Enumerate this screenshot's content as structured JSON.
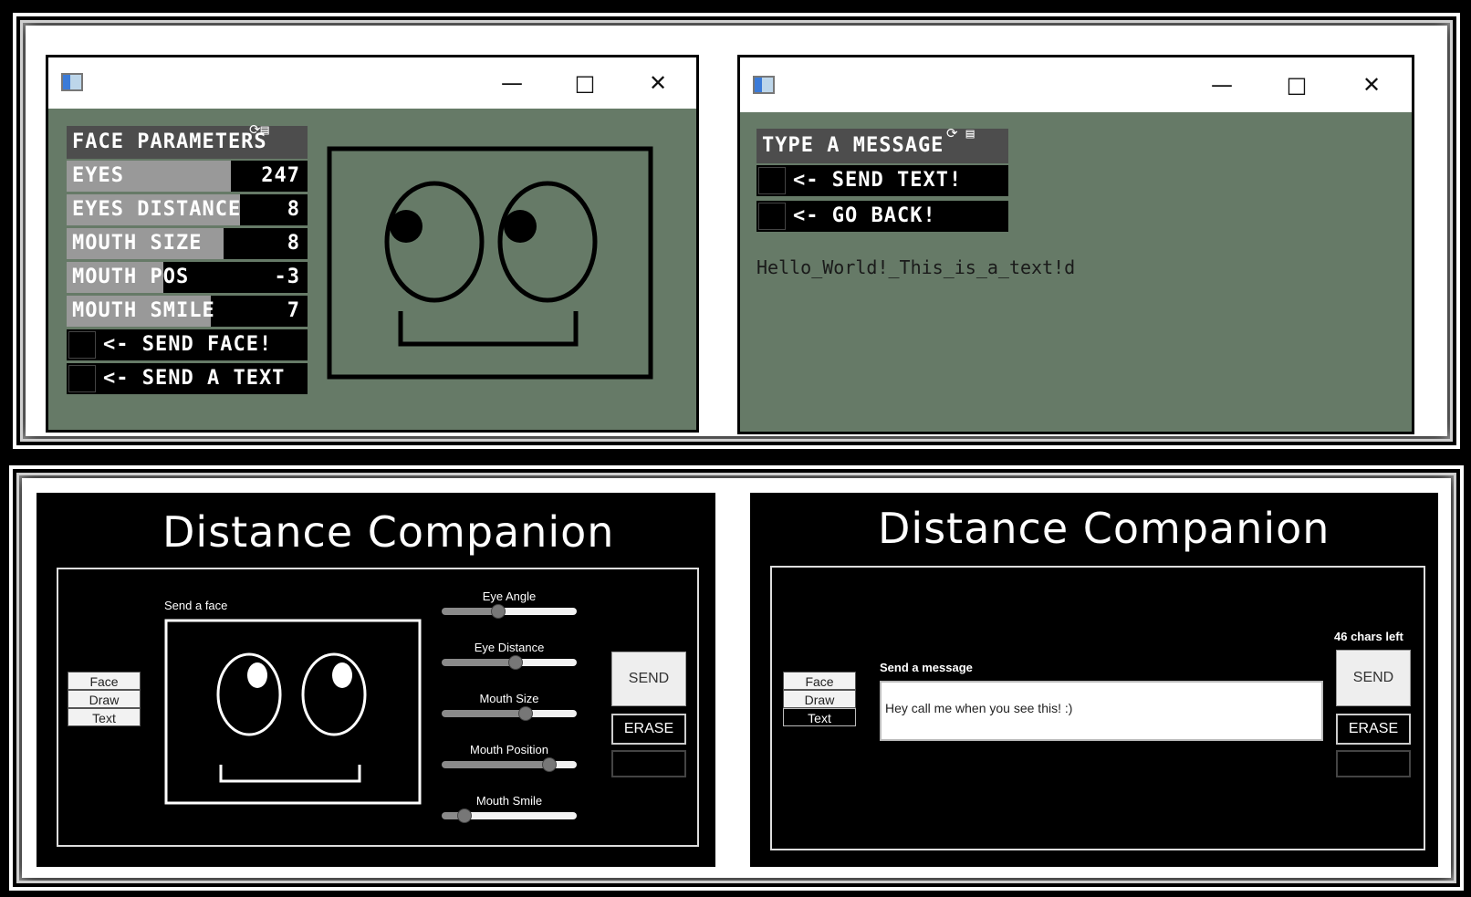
{
  "face_params_window": {
    "panel_title": "FACE PARAMETERS",
    "sliders": [
      {
        "label": "EYES",
        "value": "247",
        "fill": 0.68
      },
      {
        "label": "EYES DISTANCE",
        "value": "8",
        "fill": 0.72
      },
      {
        "label": "MOUTH SIZE",
        "value": "8",
        "fill": 0.65
      },
      {
        "label": "MOUTH POS",
        "value": "-3",
        "fill": 0.4
      },
      {
        "label": "MOUTH SMILE",
        "value": "7",
        "fill": 0.6
      }
    ],
    "buttons": [
      {
        "label": "<- SEND FACE!"
      },
      {
        "label": "<- SEND A TEXT"
      }
    ]
  },
  "message_window": {
    "panel_title": "TYPE A MESSAGE",
    "buttons": [
      {
        "label": "<- SEND TEXT!"
      },
      {
        "label": "<- GO BACK!"
      }
    ],
    "message_text": "Hello_World!_This_is_a_text!d"
  },
  "dc_face": {
    "title": "Distance Companion",
    "tabs": [
      "Face",
      "Draw",
      "Text"
    ],
    "canvas_label": "Send a face",
    "sliders": [
      {
        "label": "Eye Angle",
        "value": 0.42
      },
      {
        "label": "Eye Distance",
        "value": 0.55
      },
      {
        "label": "Mouth Size",
        "value": 0.62
      },
      {
        "label": "Mouth Position",
        "value": 0.8
      },
      {
        "label": "Mouth Smile",
        "value": 0.17
      }
    ],
    "send_label": "SEND",
    "erase_label": "ERASE"
  },
  "dc_text": {
    "title": "Distance Companion",
    "tabs": [
      "Face",
      "Draw",
      "Text"
    ],
    "chars_left": "46 chars left",
    "message_label": "Send a message",
    "message_value": "Hey call me when you see this! :)",
    "send_label": "SEND",
    "erase_label": "ERASE"
  },
  "colors": {
    "window_bg": "#667a67",
    "dark_panel": "#000000"
  }
}
